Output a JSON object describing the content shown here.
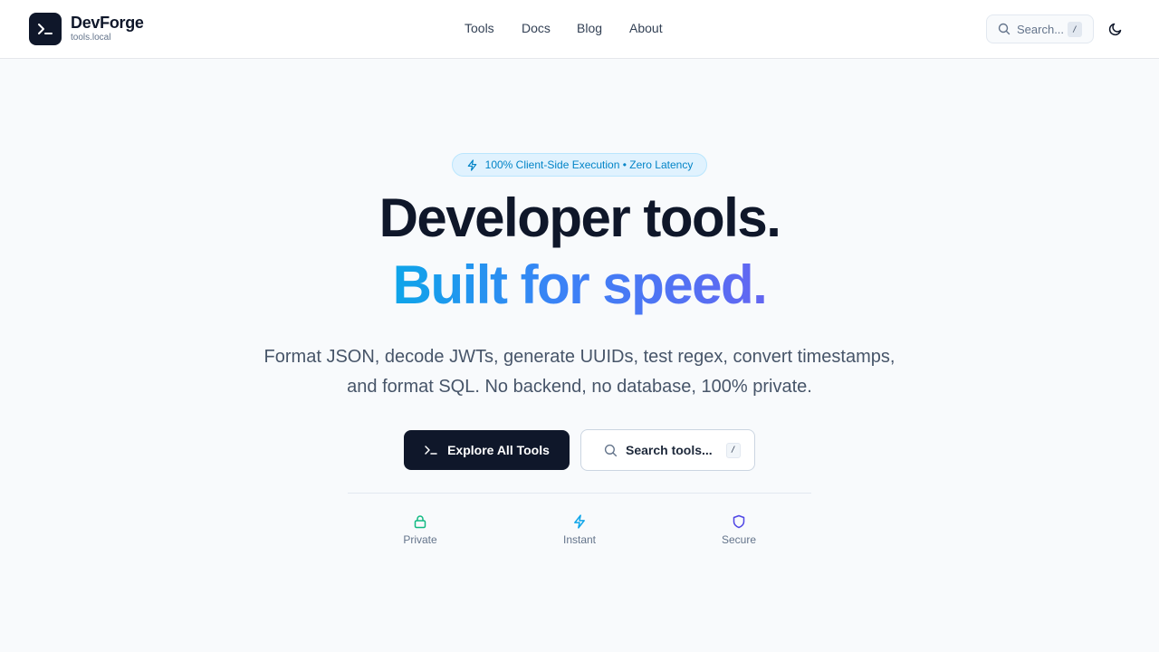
{
  "brand": {
    "name": "DevForge",
    "subtitle": "tools.local"
  },
  "nav": [
    {
      "label": "Tools"
    },
    {
      "label": "Docs"
    },
    {
      "label": "Blog"
    },
    {
      "label": "About"
    }
  ],
  "header_search": {
    "placeholder": "Search...",
    "shortcut": "/",
    "icon": "search-icon"
  },
  "theme_toggle": {
    "icon": "moon-icon"
  },
  "hero": {
    "badge": {
      "text": "100% Client-Side Execution • Zero Latency",
      "icon": "lightning-icon"
    },
    "title_line1": "Developer tools.",
    "title_line2": "Built for speed.",
    "description": "Format JSON, decode JWTs, generate UUIDs, test regex, convert timestamps, and format SQL. No backend, no database, 100% private.",
    "primary_button": {
      "label": "Explore All Tools",
      "icon": "terminal-icon"
    },
    "secondary_button": {
      "label": "Search tools...",
      "shortcut": "/",
      "icon": "search-icon"
    }
  },
  "features": [
    {
      "label": "Private",
      "icon": "lock-icon",
      "color": "#10b981"
    },
    {
      "label": "Instant",
      "icon": "lightning-icon",
      "color": "#0ea5e9"
    },
    {
      "label": "Secure",
      "icon": "shield-icon",
      "color": "#4f46e5"
    }
  ],
  "colors": {
    "primary": "#0f172a",
    "accent_gradient": [
      "#0ea5e9",
      "#3b82f6",
      "#6366f1"
    ],
    "badge_bg": "#e0f2fe",
    "badge_text": "#0284c7",
    "background": "#f8fafc"
  }
}
